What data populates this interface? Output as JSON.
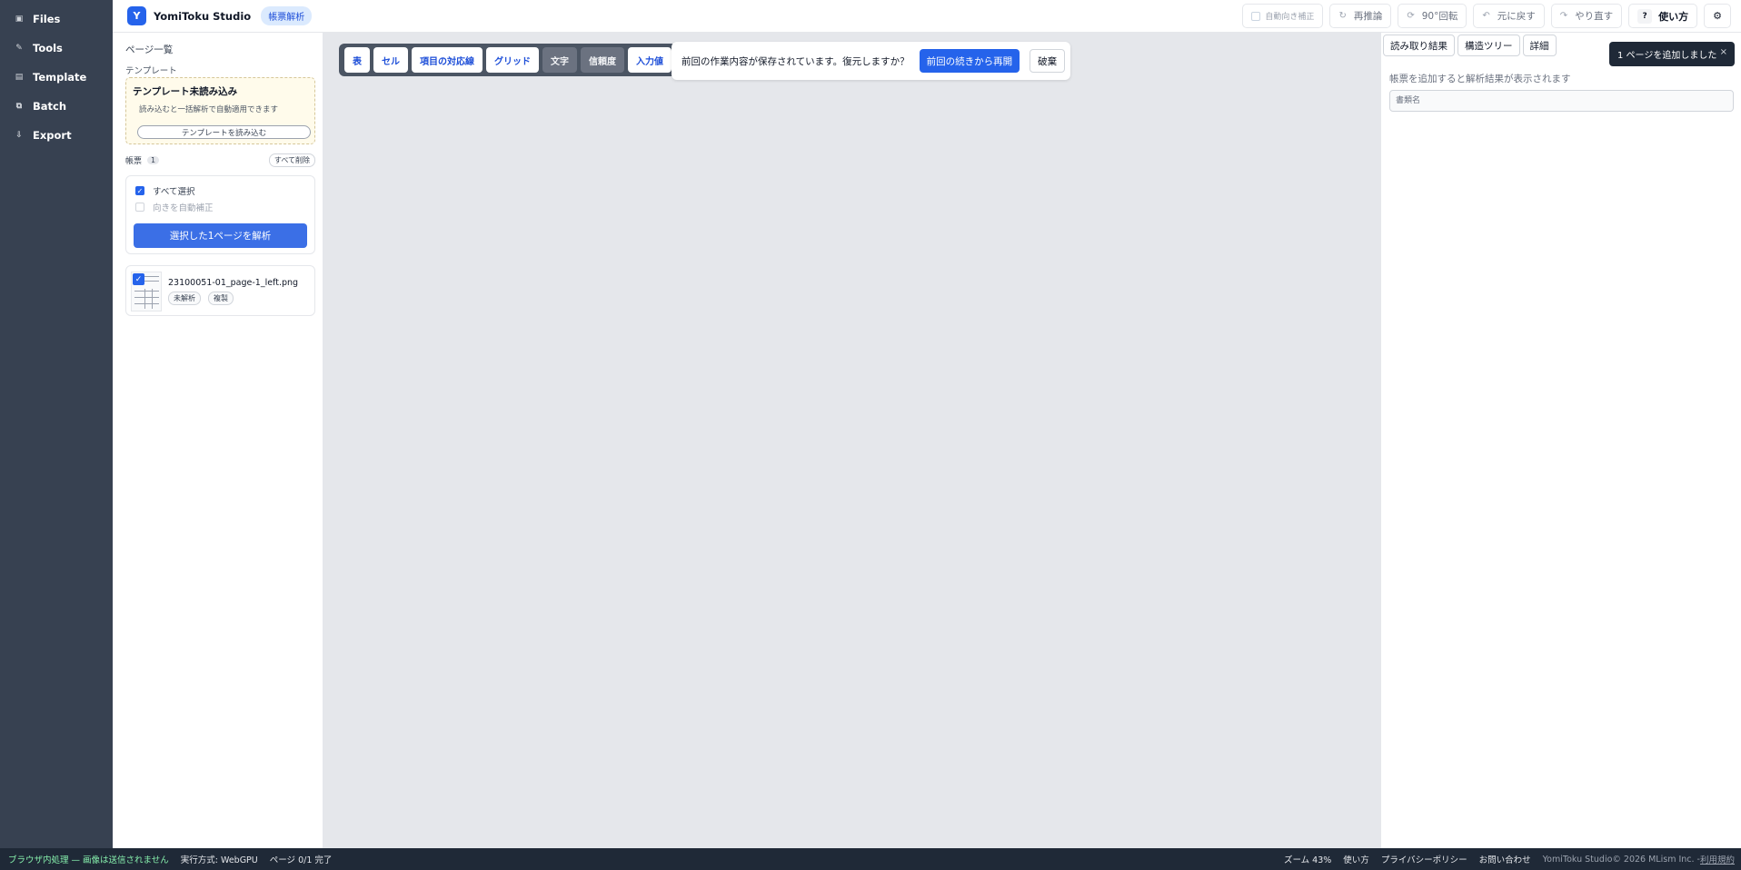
{
  "nav": {
    "items": [
      {
        "label": "Files",
        "icon": "files-icon",
        "glyph": "▣"
      },
      {
        "label": "Tools",
        "icon": "tools-icon",
        "glyph": "✎"
      },
      {
        "label": "Template",
        "icon": "template-icon",
        "glyph": "▤"
      },
      {
        "label": "Batch",
        "icon": "batch-icon",
        "glyph": "⧉"
      },
      {
        "label": "Export",
        "icon": "export-icon",
        "glyph": "⇩"
      }
    ]
  },
  "header": {
    "logo_letter": "Y",
    "app_title": "YomiToku Studio",
    "mode_label": "帳票解析",
    "auto_orient_label": "自動向き補正",
    "reinfer_label": "再推論",
    "rotate_label": "90°回転",
    "undo_label": "元に戻す",
    "redo_label": "やり直す",
    "help_label": "使い方",
    "help_glyph": "?",
    "settings_glyph": "⚙"
  },
  "sidebar": {
    "title": "ページ一覧",
    "template_section": "テンプレート",
    "template_status": "テンプレート未読み込み",
    "template_desc": "読み込むと一括解析で自動適用できます",
    "template_load_button": "テンプレートを読み込む",
    "forms_label": "帳票",
    "forms_count": "1",
    "clear_all_button": "すべて削除",
    "select_all_label": "すべて選択",
    "select_all_checked": true,
    "auto_orient_label": "向きを自動補正",
    "auto_orient_checked": false,
    "parse_button": "選択した1ページを解析",
    "files": [
      {
        "name": "23100051-01_page-1_left.png",
        "tags": [
          "未解析",
          "複製"
        ],
        "checked": true
      }
    ]
  },
  "canvas": {
    "toolbar": [
      {
        "label": "表",
        "active": true
      },
      {
        "label": "セル",
        "active": true
      },
      {
        "label": "項目の対応線",
        "active": true
      },
      {
        "label": "グリッド",
        "active": true
      },
      {
        "label": "文字",
        "active": false
      },
      {
        "label": "信頼度",
        "active": false
      },
      {
        "label": "入力値",
        "active": true
      }
    ],
    "restore_message": "前回の作業内容が保存されています。復元しますか？",
    "resume_button": "前回の続きから再開",
    "discard_button": "破棄"
  },
  "right_panel": {
    "tabs": [
      "読み取り結果",
      "構造ツリー",
      "詳細"
    ],
    "empty_message": "帳票を追加すると解析結果が表示されます",
    "doc_name_placeholder": "書類名"
  },
  "toast": {
    "message": "1 ページを追加しました",
    "close_glyph": "×"
  },
  "status": {
    "privacy": "ブラウザ内処理 — 画像は送信されません",
    "runtime": "実行方式: WebGPU",
    "pages": "ページ 0/1 完了",
    "zoom": "ズーム 43%",
    "usage_link": "使い方",
    "privacy_policy_link": "プライバシーポリシー",
    "contact_link": "お問い合わせ",
    "copyright": "YomiToku Studio© 2026 MLism Inc. - ",
    "terms_link": "利用規約"
  },
  "colors": {
    "accent": "#2563eb",
    "nav_bg": "#374151",
    "status_bg": "#1f2937",
    "canvas_bg": "#e5e7eb"
  }
}
